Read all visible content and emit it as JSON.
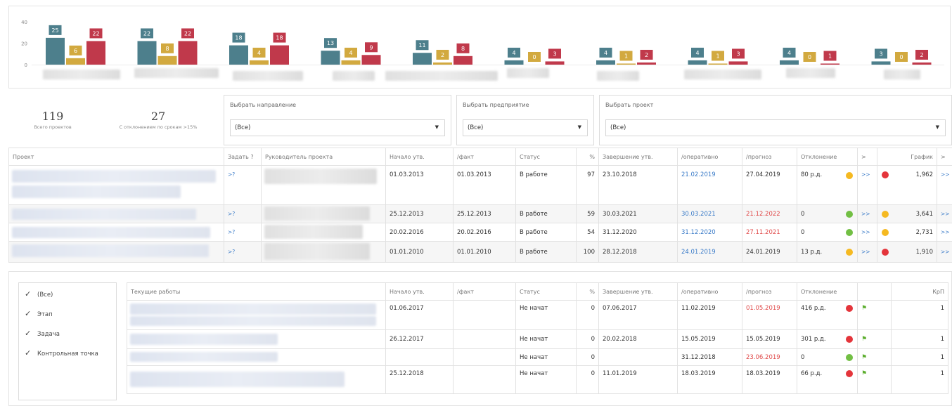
{
  "chart_data": {
    "type": "bar",
    "ylim": [
      0,
      40
    ],
    "yticks": [
      0,
      20,
      40
    ],
    "categories": [
      "",
      "",
      "",
      "",
      "",
      "",
      "",
      "",
      "",
      ""
    ],
    "series": [
      {
        "color": "#4d7f8c",
        "values": [
          25,
          22,
          18,
          13,
          11,
          4,
          4,
          4,
          4,
          3
        ]
      },
      {
        "color": "#d2a93f",
        "values": [
          6,
          8,
          4,
          4,
          2,
          0,
          1,
          1,
          0,
          0
        ]
      },
      {
        "color": "#c0394b",
        "values": [
          22,
          22,
          18,
          9,
          8,
          3,
          2,
          3,
          1,
          2
        ]
      }
    ]
  },
  "summary": {
    "total_value": "119",
    "total_label": "Всего проектов",
    "deviation_value": "27",
    "deviation_label": "С отклонением по срокам >15%"
  },
  "filters": [
    {
      "title": "Выбрать направление",
      "value": "(Все)"
    },
    {
      "title": "Выбрать предприятие",
      "value": "(Все)"
    },
    {
      "title": "Выбрать проект",
      "value": "(Все)"
    }
  ],
  "projects": {
    "headers": [
      "Проект",
      "Задать ?",
      "Руководитель проекта",
      "Начало утв.",
      "/факт",
      "Статус",
      "%",
      "Завершение утв.",
      "/оперативно",
      "/прогноз",
      "Отклонение",
      ">",
      "График",
      ">"
    ],
    "rows": [
      {
        "ask": ">?",
        "start": "01.03.2013",
        "fact": "01.03.2013",
        "status": "В работе",
        "pct": "97",
        "end": "23.10.2018",
        "oper": "21.02.2019",
        "forecast": "27.04.2019",
        "dev": "80 р.д.",
        "dev_color": "yellow",
        "more1": ">>",
        "sched_color": "red",
        "sched": "1,962",
        "more2": ">>"
      },
      {
        "ask": ">?",
        "start": "25.12.2013",
        "fact": "25.12.2013",
        "status": "В работе",
        "pct": "59",
        "end": "30.03.2021",
        "oper": "30.03.2021",
        "forecast": "21.12.2022",
        "dev": "0",
        "dev_color": "green",
        "more1": ">>",
        "sched_color": "yellow",
        "sched": "3,641",
        "more2": ">>"
      },
      {
        "ask": ">?",
        "start": "20.02.2016",
        "fact": "20.02.2016",
        "status": "В работе",
        "pct": "54",
        "end": "31.12.2020",
        "oper": "31.12.2020",
        "forecast": "27.11.2021",
        "dev": "0",
        "dev_color": "green",
        "more1": ">>",
        "sched_color": "yellow",
        "sched": "2,731",
        "more2": ">>"
      },
      {
        "ask": ">?",
        "start": "01.01.2010",
        "fact": "01.01.2010",
        "status": "В работе",
        "pct": "100",
        "end": "28.12.2018",
        "oper": "24.01.2019",
        "forecast": "24.01.2019",
        "dev": "13 р.д.",
        "dev_color": "yellow",
        "more1": ">>",
        "sched_color": "red",
        "sched": "1,910",
        "more2": ">>"
      }
    ]
  },
  "checklist": [
    {
      "label": "(Все)",
      "checked": "✓"
    },
    {
      "label": "Этап",
      "checked": "✓"
    },
    {
      "label": "Задача",
      "checked": "✓"
    },
    {
      "label": "Контрольная точка",
      "checked": "✓"
    }
  ],
  "works": {
    "headers": [
      "Текущие работы",
      "Начало утв.",
      "/факт",
      "Статус",
      "%",
      "Завершение утв.",
      "/оперативно",
      "/прогноз",
      "Отклонение",
      "",
      "КрП"
    ],
    "rows": [
      {
        "start": "01.06.2017",
        "fact": "",
        "status": "Не начат",
        "pct": "0",
        "end": "07.06.2017",
        "oper": "11.02.2019",
        "forecast": "01.05.2019",
        "dev": "416 р.д.",
        "dev_color": "red",
        "krp": "1"
      },
      {
        "start": "26.12.2017",
        "fact": "",
        "status": "Не начат",
        "pct": "0",
        "end": "20.02.2018",
        "oper": "15.05.2019",
        "forecast": "15.05.2019",
        "dev": "301 р.д.",
        "dev_color": "red",
        "krp": "1"
      },
      {
        "start": "",
        "fact": "",
        "status": "Не начат",
        "pct": "0",
        "end": "",
        "oper": "31.12.2018",
        "forecast": "23.06.2019",
        "dev": "0",
        "dev_color": "green",
        "krp": "1"
      },
      {
        "start": "25.12.2018",
        "fact": "",
        "status": "Не начат",
        "pct": "0",
        "end": "11.01.2019",
        "oper": "18.03.2019",
        "forecast": "18.03.2019",
        "dev": "66 р.д.",
        "dev_color": "red",
        "krp": "1"
      }
    ]
  }
}
